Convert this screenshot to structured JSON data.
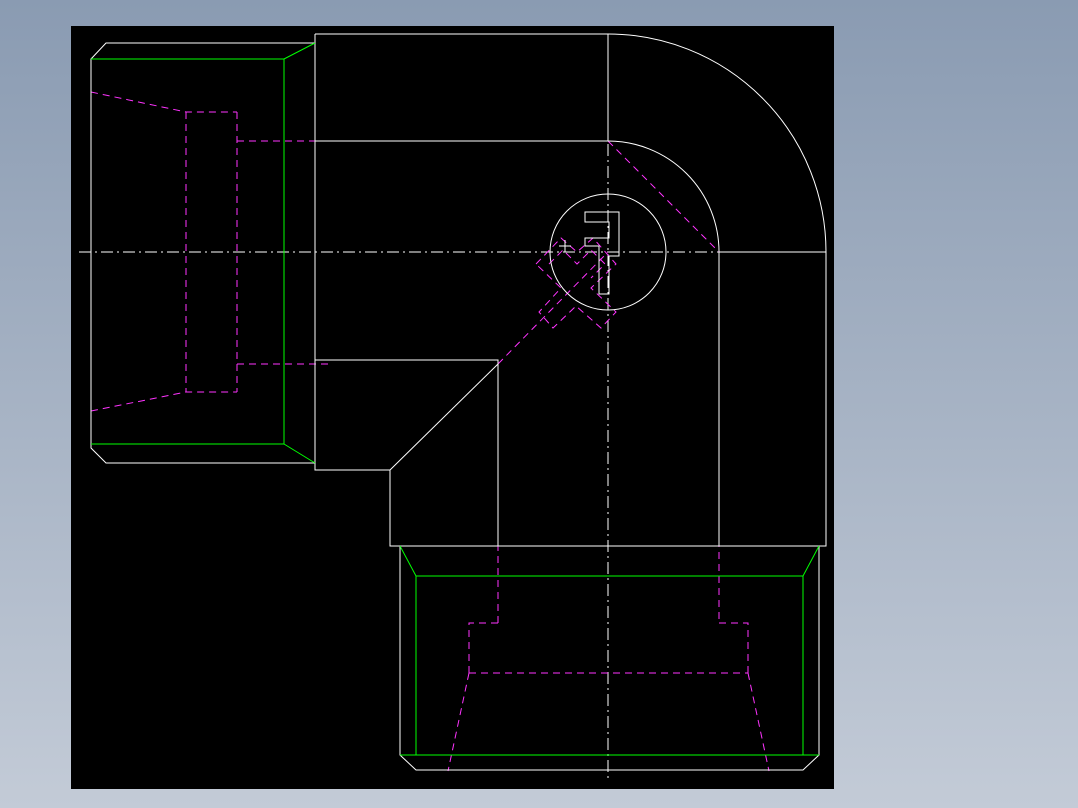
{
  "drawing": {
    "background_color": "#000000",
    "colors": {
      "outline": "#ffffff",
      "thread": "#00ff00",
      "hidden": "#ff33ff",
      "centerline": "#ffffff"
    },
    "line_types": [
      "outline",
      "thread",
      "hidden",
      "centerline"
    ],
    "logo": {
      "letter": "P",
      "kind": "manufacturer-logo"
    }
  }
}
